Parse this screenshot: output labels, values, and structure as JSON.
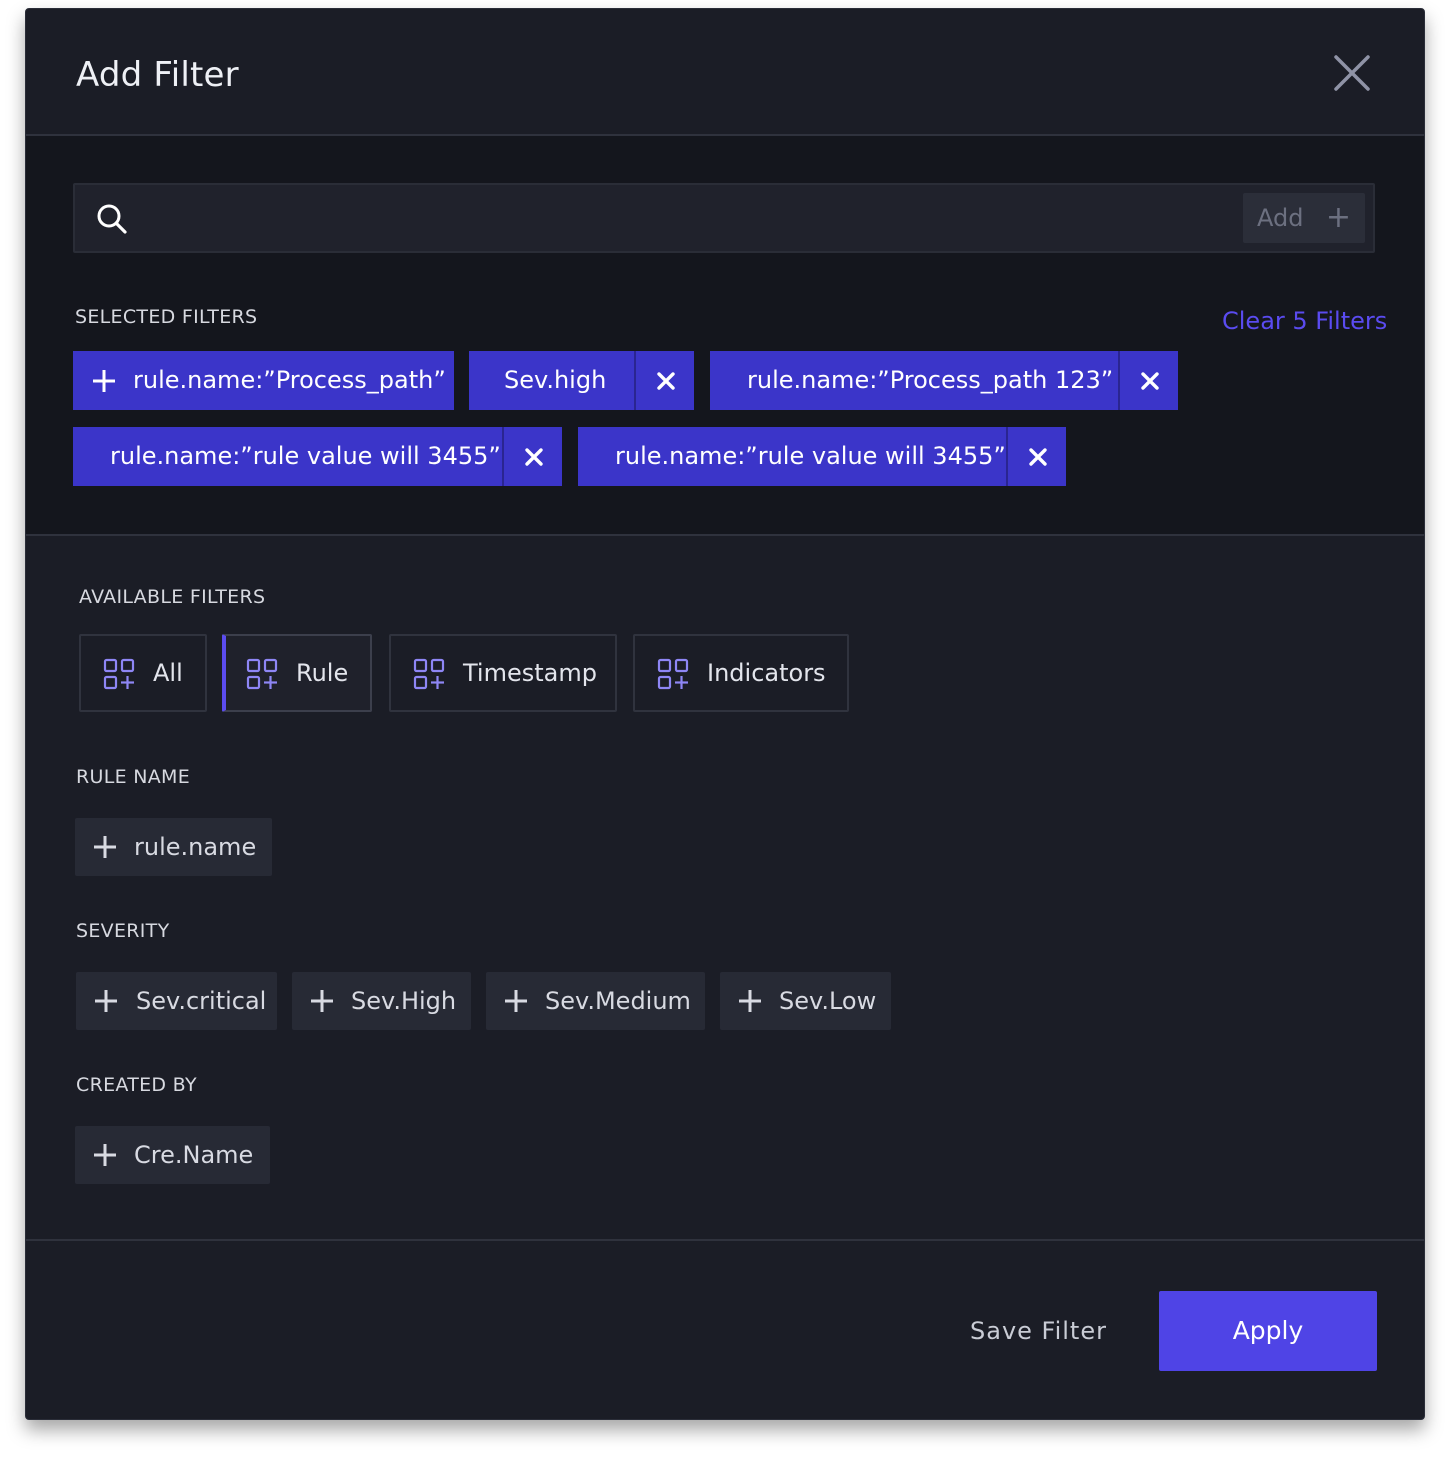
{
  "dialog": {
    "title": "Add Filter"
  },
  "search": {
    "value": "",
    "placeholder": "",
    "add_label": "Add"
  },
  "selected": {
    "heading": "SELECTED FILTERS",
    "clear_label": "Clear 5 Filters",
    "chips": [
      {
        "label": "rule.name:”Process_path”",
        "has_plus": true
      },
      {
        "label": "Sev.high",
        "removable": true
      },
      {
        "label": "rule.name:”Process_path 123”",
        "removable": true
      },
      {
        "label": "rule.name:”rule value will 3455”",
        "removable": true
      },
      {
        "label": "rule.name:”rule value will 3455”",
        "removable": true
      }
    ]
  },
  "available": {
    "heading": "AVAILABLE FILTERS",
    "tabs": [
      {
        "label": "All"
      },
      {
        "label": "Rule",
        "active": true
      },
      {
        "label": "Timestamp"
      },
      {
        "label": "Indicators"
      }
    ],
    "groups": [
      {
        "heading": "RULE NAME",
        "options": [
          "rule.name"
        ]
      },
      {
        "heading": "SEVERITY",
        "options": [
          "Sev.critical",
          "Sev.High",
          "Sev.Medium",
          "Sev.Low"
        ]
      },
      {
        "heading": "CREATED BY",
        "options": [
          "Cre.Name"
        ]
      }
    ]
  },
  "footer": {
    "save_label": "Save Filter",
    "apply_label": "Apply"
  },
  "colors": {
    "accent": "#4f44e6",
    "chip": "#3b35c9",
    "link": "#5a4bf0",
    "background": "#1b1d26"
  },
  "icons": [
    "close-icon",
    "search-icon",
    "plus-icon",
    "grid-add-icon"
  ]
}
